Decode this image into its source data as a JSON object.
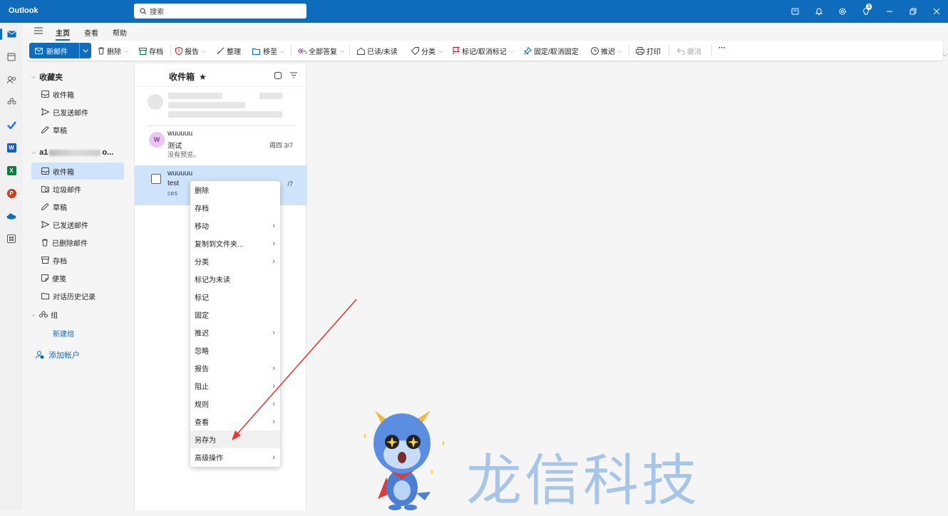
{
  "app": {
    "title": "Outlook"
  },
  "search": {
    "placeholder": "搜索"
  },
  "titlebar": {
    "notification_count": "1"
  },
  "menubar": {
    "items": [
      "主页",
      "查看",
      "帮助"
    ]
  },
  "ribbon": {
    "new_mail": "新邮件",
    "delete": "删除",
    "archive": "存档",
    "report": "报告",
    "sweep": "整理",
    "move_to": "移至",
    "reply_all": "全部答复",
    "read_unread": "已读/未读",
    "categorize": "分类",
    "flag": "标记/取消标记",
    "pin": "固定/取消固定",
    "snooze": "推迟",
    "print": "打印",
    "undo": "撤消",
    "more": "···"
  },
  "folders": {
    "favorites_label": "收藏夹",
    "favorites": [
      "收件箱",
      "已发送邮件",
      "草稿"
    ],
    "account_label_start": "a1",
    "account_label_end": "o...",
    "account": [
      "收件箱",
      "垃圾邮件",
      "草稿",
      "已发送邮件",
      "已删除邮件",
      "存档",
      "便笺",
      "对话历史记录"
    ],
    "groups_label": "组",
    "new_group": "新建组",
    "add_account": "添加帐户"
  },
  "list": {
    "title": "收件箱",
    "messages": [
      {
        "avatar": "W",
        "sender": "wuuuuu",
        "subject": "测试",
        "preview": "没有预览。",
        "date": "周四 3/7"
      },
      {
        "sender": "wuuuuu",
        "subject": "test",
        "preview": "ces",
        "date": "/7"
      }
    ]
  },
  "context_menu": {
    "items": [
      {
        "label": "删除",
        "submenu": false
      },
      {
        "label": "存档",
        "submenu": false
      },
      {
        "label": "移动",
        "submenu": true
      },
      {
        "label": "复制到文件夹...",
        "submenu": true
      },
      {
        "label": "分类",
        "submenu": true
      },
      {
        "label": "标记为未读",
        "submenu": false
      },
      {
        "label": "标记",
        "submenu": false
      },
      {
        "label": "固定",
        "submenu": false
      },
      {
        "label": "推迟",
        "submenu": true
      },
      {
        "label": "忽略",
        "submenu": false
      },
      {
        "label": "报告",
        "submenu": true
      },
      {
        "label": "阻止",
        "submenu": true
      },
      {
        "label": "规则",
        "submenu": true
      },
      {
        "label": "查看",
        "submenu": true
      },
      {
        "label": "另存为",
        "submenu": false
      },
      {
        "label": "高级操作",
        "submenu": true
      }
    ],
    "highlighted": "另存为"
  },
  "watermark": {
    "text": "龙信科技"
  },
  "colors": {
    "brand": "#0f6cbd",
    "selected": "#cfe4fa",
    "arrow": "#e53935"
  }
}
